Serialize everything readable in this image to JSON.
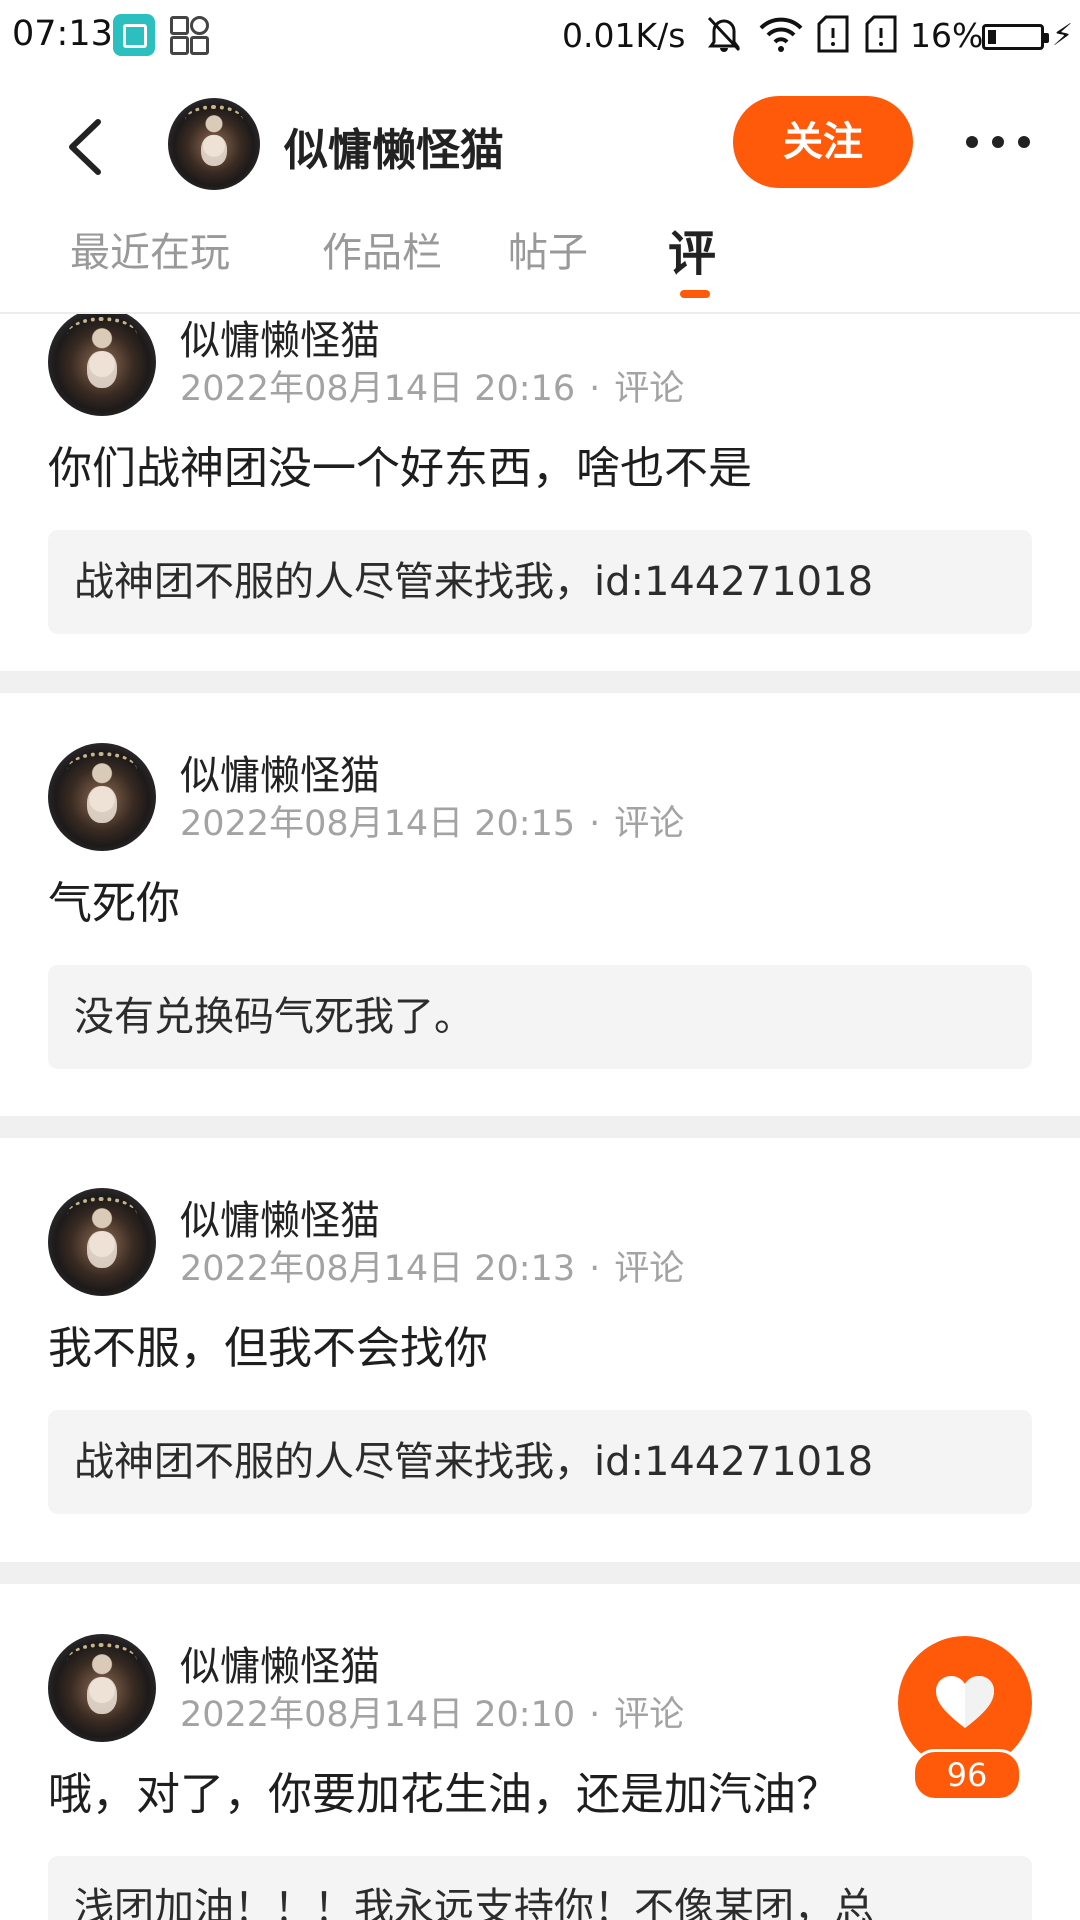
{
  "status_bar": {
    "time": "07:13",
    "net_speed": "0.01K/s",
    "battery": "16%",
    "icons": [
      "screenshot-app-icon",
      "apps-icon",
      "mute-bell-icon",
      "wifi-icon",
      "sim1-icon",
      "sim2-icon",
      "battery-icon",
      "charging-icon"
    ]
  },
  "header": {
    "name": "似慵懒怪猫",
    "follow_label": "关注"
  },
  "tabs": [
    {
      "label": "最近在玩"
    },
    {
      "label": "作品栏"
    },
    {
      "label": "帖子"
    },
    {
      "label": "评"
    }
  ],
  "active_tab": 3,
  "posts": [
    {
      "name": "似慵懒怪猫",
      "date": "2022年08月14日 20:16",
      "type": "评论",
      "text": "你们战神团没一个好东西，啥也不是",
      "quote": "战神团不服的人尽管来找我，id:144271018"
    },
    {
      "name": "似慵懒怪猫",
      "date": "2022年08月14日 20:15",
      "type": "评论",
      "text": "气死你",
      "quote": "没有兑换码气死我了。"
    },
    {
      "name": "似慵懒怪猫",
      "date": "2022年08月14日 20:13",
      "type": "评论",
      "text": "我不服，但我不会找你",
      "quote": "战神团不服的人尽管来找我，id:144271018"
    },
    {
      "name": "似慵懒怪猫",
      "date": "2022年08月14日 20:10",
      "type": "评论",
      "text": "哦，对了，你要加花生油，还是加汽油？",
      "quote": "浅团加油！！！我永远支持你！不像某团，总"
    }
  ],
  "like": {
    "count": "96"
  },
  "colors": {
    "accent": "#ff5a0a",
    "separator": "#f0f0f0",
    "quote_bg": "#f4f4f4",
    "meta": "#a3a3a3"
  }
}
